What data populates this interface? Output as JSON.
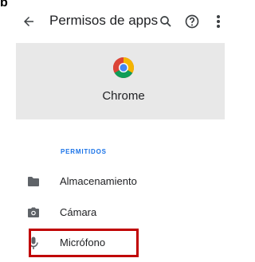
{
  "page_letter": "b",
  "appbar": {
    "title": "Permisos de apps",
    "back_icon": "arrow-back-icon",
    "actions": [
      "search-icon",
      "help-icon",
      "overflow-menu-icon"
    ]
  },
  "app": {
    "name": "Chrome",
    "icon": "chrome-logo-icon"
  },
  "section": {
    "label": "PERMITIDOS"
  },
  "permissions": [
    {
      "label": "Almacenamiento",
      "icon": "folder-icon"
    },
    {
      "label": "Cámara",
      "icon": "camera-icon"
    },
    {
      "label": "Micrófono",
      "icon": "microphone-icon"
    }
  ],
  "colors": {
    "accent": "#1a73e8",
    "highlight": "#c00000",
    "header_bg": "#e8e8e8",
    "icon": "#5f6368"
  }
}
